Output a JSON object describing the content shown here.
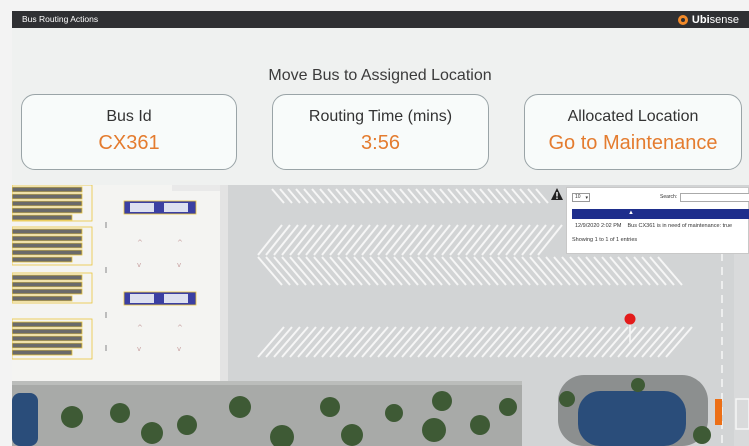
{
  "window": {
    "title": "Bus Routing Actions",
    "brand": {
      "icon": "ubisense-logo-icon",
      "name_bold": "Ubi",
      "name_thin": "sense"
    }
  },
  "main": {
    "heading": "Move Bus to Assigned Location",
    "cards": [
      {
        "label": "Bus Id",
        "value": "CX361"
      },
      {
        "label": "Routing Time (mins)",
        "value": "3:56"
      },
      {
        "label": "Allocated Location",
        "value": "Go to Maintenance"
      }
    ]
  },
  "events_popup": {
    "warning_icon": "warning-triangle-icon",
    "page_length": "10",
    "search_label": "Search:",
    "search_value": "",
    "sort_indicator": "▲",
    "rows": [
      {
        "time": "12/9/2020 2:02 PM",
        "message": "Bus CX361 is in need of maintenance: true"
      }
    ],
    "info": "Showing 1 to 1 of 1 entries"
  },
  "map": {
    "pin_icon": "location-pin-icon",
    "colors": {
      "accent": "#e47c2f",
      "header_bar": "#2f3033",
      "table_header": "#1e2e8c",
      "pin": "#e31b1b",
      "bus_stripes": "#3b3fa2",
      "trees": "#3e5a35",
      "water": "#2a4d7a"
    }
  }
}
